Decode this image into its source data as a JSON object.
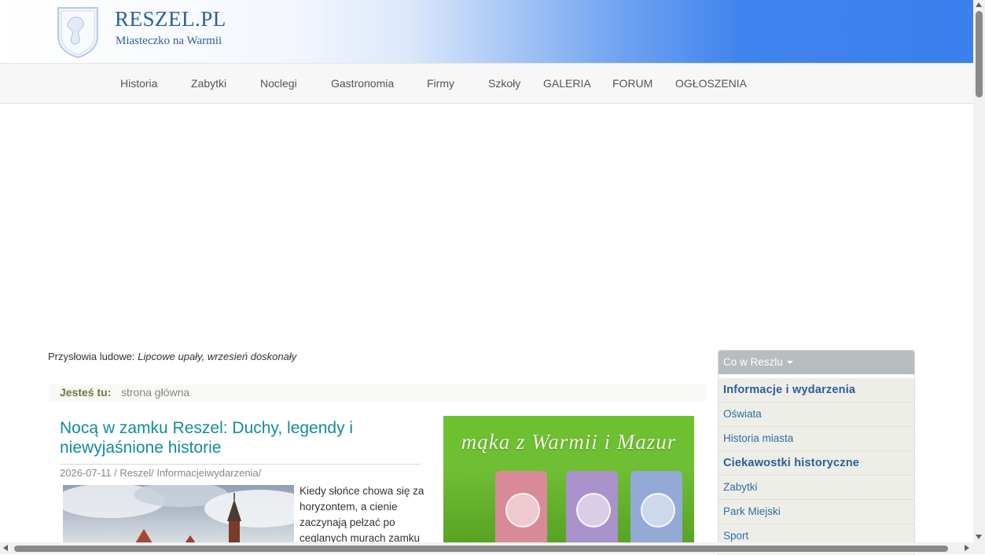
{
  "header": {
    "title": "RESZEL.PL",
    "subtitle": "Miasteczko na Warmii",
    "logo_icon": "town-crest-shield-icon"
  },
  "nav": {
    "items": [
      {
        "label": "Historia"
      },
      {
        "label": "Zabytki"
      },
      {
        "label": "Noclegi"
      },
      {
        "label": "Gastronomia"
      },
      {
        "label": "Firmy"
      },
      {
        "label": "Szkoły"
      },
      {
        "label": "GALERIA"
      },
      {
        "label": "FORUM"
      },
      {
        "label": "OGŁOSZENIA"
      }
    ]
  },
  "proverb": {
    "label": "Przysłowia ludowe:",
    "text": "Lipcowe upały, wrzesień doskonały"
  },
  "breadcrumb": {
    "label": "Jesteś tu:",
    "link": "strona główna"
  },
  "article": {
    "title": "Nocą w zamku Reszel: Duchy, legendy i niewyjaśnione historie",
    "meta": "2026-07-11 / Reszel/ Informacjeiwydarzenia/",
    "excerpt": "Kiedy słońce chowa się za horyzontem, a cienie zaczynają pełzać po ceglanych murach zamku"
  },
  "banner": {
    "text": "mąka z Warmii i Mazur"
  },
  "sidebar": {
    "header": "Co w Reszlu",
    "items": [
      {
        "label": "Informacje i wydarzenia",
        "bold": true
      },
      {
        "label": "Oświata",
        "bold": false
      },
      {
        "label": "Historia miasta",
        "bold": false
      },
      {
        "label": "Ciekawostki historyczne",
        "bold": true
      },
      {
        "label": "Zabytki",
        "bold": false
      },
      {
        "label": "Park Miejski",
        "bold": false
      },
      {
        "label": "Sport",
        "bold": false
      }
    ]
  },
  "colors": {
    "brand": "#2b5fa3",
    "header_blue": "#3a80ee",
    "article_title": "#138c9c",
    "sidebar_link": "#2f6ea8"
  }
}
